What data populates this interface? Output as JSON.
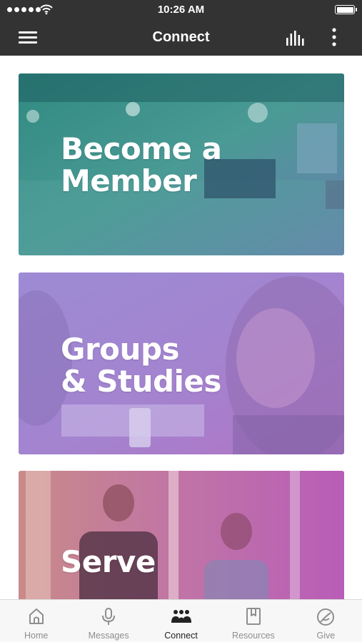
{
  "status_bar": {
    "time": "10:26 AM"
  },
  "nav": {
    "title": "Connect"
  },
  "cards": [
    {
      "line1": "Become a",
      "line2": "Member"
    },
    {
      "line1": "Groups",
      "line2": "& Studies"
    },
    {
      "line1": "Serve"
    }
  ],
  "tabs": [
    {
      "label": "Home",
      "icon": "home-icon",
      "active": false
    },
    {
      "label": "Messages",
      "icon": "microphone-icon",
      "active": false
    },
    {
      "label": "Connect",
      "icon": "people-icon",
      "active": true
    },
    {
      "label": "Resources",
      "icon": "bookmark-book-icon",
      "active": false
    },
    {
      "label": "Give",
      "icon": "give-icon",
      "active": false
    }
  ],
  "colors": {
    "bar_background": "#333333",
    "card_member_tint": "#3a9a8e",
    "card_groups_tint": "#9b7fd6",
    "card_serve_tint": "#c063b6",
    "tab_active": "#222222",
    "tab_inactive": "#8e8e8e"
  }
}
